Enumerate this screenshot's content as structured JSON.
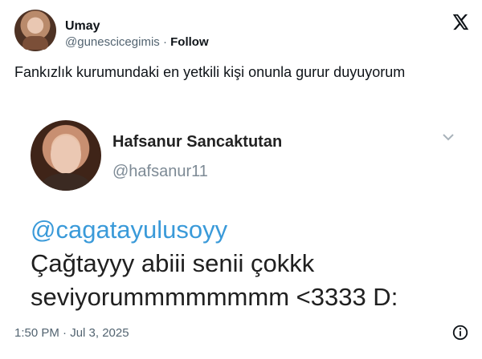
{
  "author": {
    "name": "Umay",
    "handle": "@gunescicegimis",
    "separator": "·",
    "follow_label": "Follow"
  },
  "tweet": {
    "text": "Fankızlık kurumundaki en yetkili kişi onunla gurur duyuyorum"
  },
  "quoted_image": {
    "name": "Hafsanur Sancaktutan",
    "handle": "@hafsanur11",
    "mention": "@cagatayulusoyy",
    "line1": "Çağtayyy abiii senii çokkk",
    "line2": "seviyorummmmmmmm <3333 D:"
  },
  "footer": {
    "timestamp": "1:50 PM · Jul 3, 2025"
  },
  "icons": {
    "platform": "x-logo-icon",
    "dropdown": "chevron-down-icon",
    "info": "info-icon"
  },
  "colors": {
    "mention": "#3a9ad9",
    "secondary_text": "#536471"
  }
}
